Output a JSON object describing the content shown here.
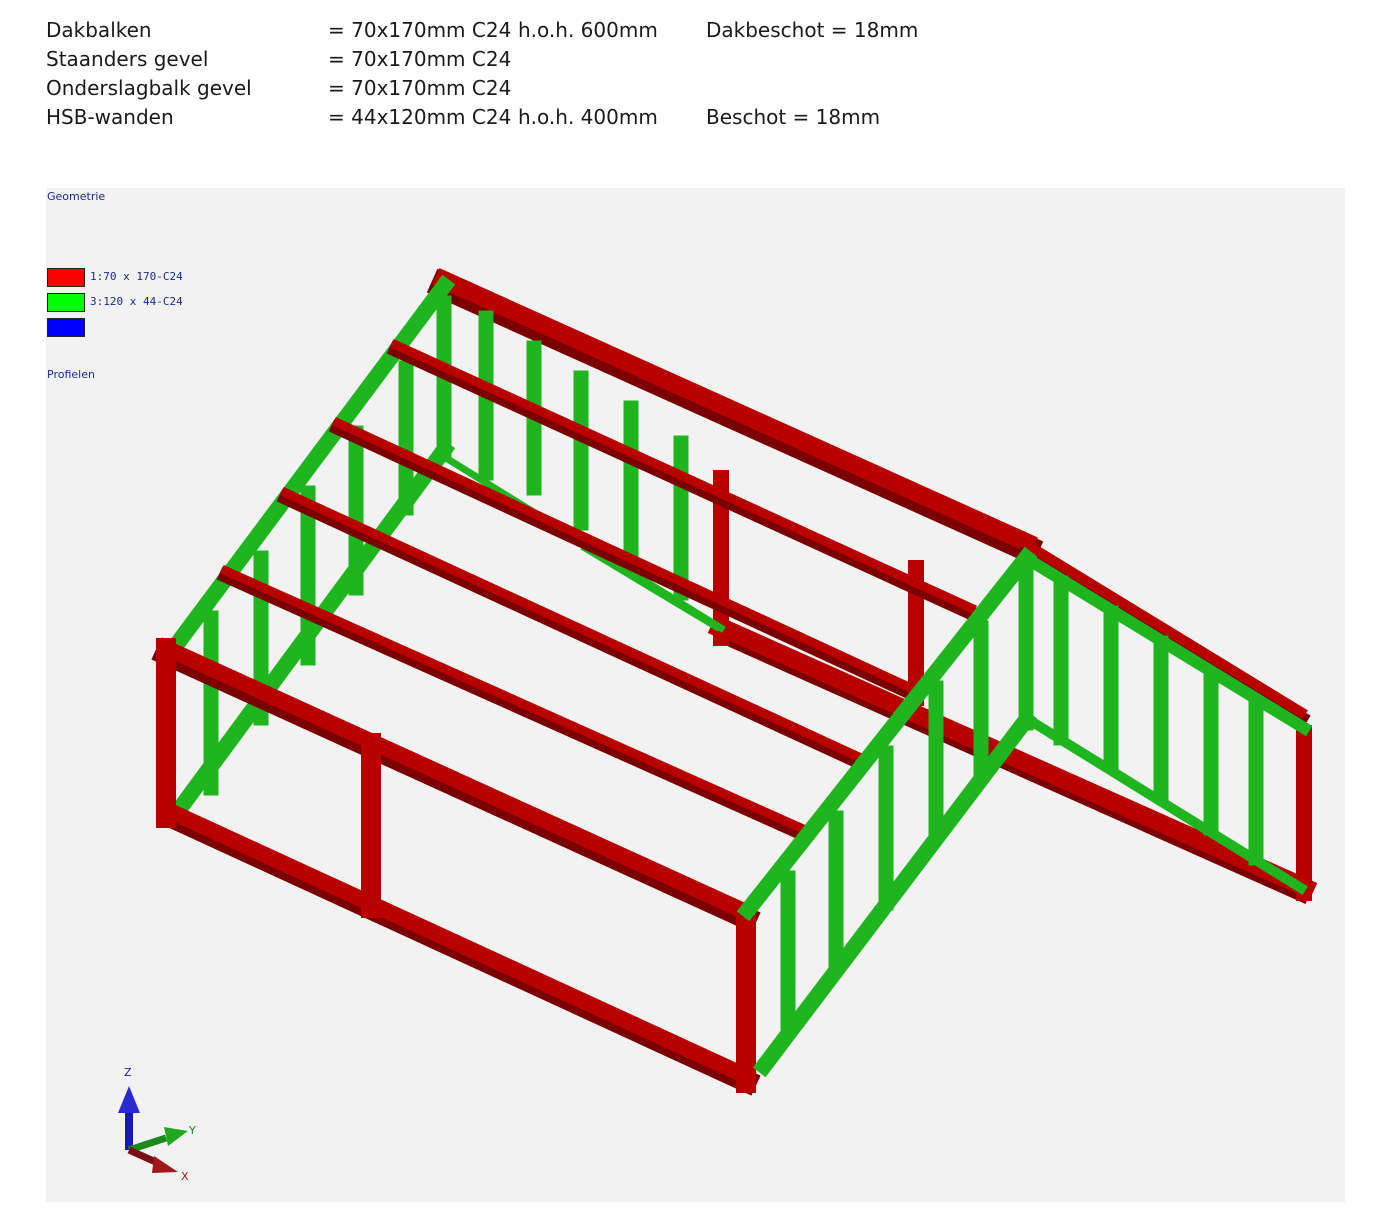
{
  "specs": [
    {
      "name": "Dakbalken",
      "size": "= 70x170mm C24",
      "spacing": "h.o.h. 600mm",
      "note": "Dakbeschot = 18mm"
    },
    {
      "name": "Staanders gevel",
      "size": "= 70x170mm C24",
      "spacing": "",
      "note": ""
    },
    {
      "name": "Onderslagbalk gevel",
      "size": "= 70x170mm C24",
      "spacing": "",
      "note": ""
    },
    {
      "name": "HSB-wanden",
      "size": "= 44x120mm C24",
      "spacing": "h.o.h. 400mm",
      "note": "Beschot = 18mm"
    }
  ],
  "viewer": {
    "title": "Geometrie",
    "profiles_label": "Profielen",
    "legend": [
      {
        "label": "1:70 x 170-C24",
        "color": "#ff0000"
      },
      {
        "label": "3:120 x 44-C24",
        "color": "#00ff00"
      },
      {
        "label": "",
        "color": "#0000ff"
      }
    ],
    "axes": {
      "z": "Z",
      "y": "Y",
      "x": "X"
    },
    "colors": {
      "timber_red": "#b80000",
      "timber_green": "#1fb51f",
      "background": "#f2f2f2"
    }
  }
}
